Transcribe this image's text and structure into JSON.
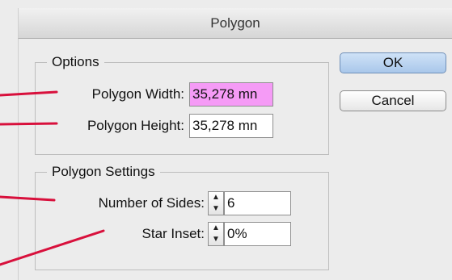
{
  "window": {
    "title": "Polygon"
  },
  "options": {
    "legend": "Options",
    "width_label": "Polygon Width:",
    "width_value": "35,278 mn",
    "height_label": "Polygon Height:",
    "height_value": "35,278 mn"
  },
  "settings": {
    "legend": "Polygon Settings",
    "sides_label": "Number of Sides:",
    "sides_value": "6",
    "inset_label": "Star Inset:",
    "inset_value": "0%"
  },
  "buttons": {
    "ok": "OK",
    "cancel": "Cancel"
  },
  "colors": {
    "highlight": "#f59bf6",
    "callout": "#d8103c",
    "default_button": "#a9c7ea"
  }
}
